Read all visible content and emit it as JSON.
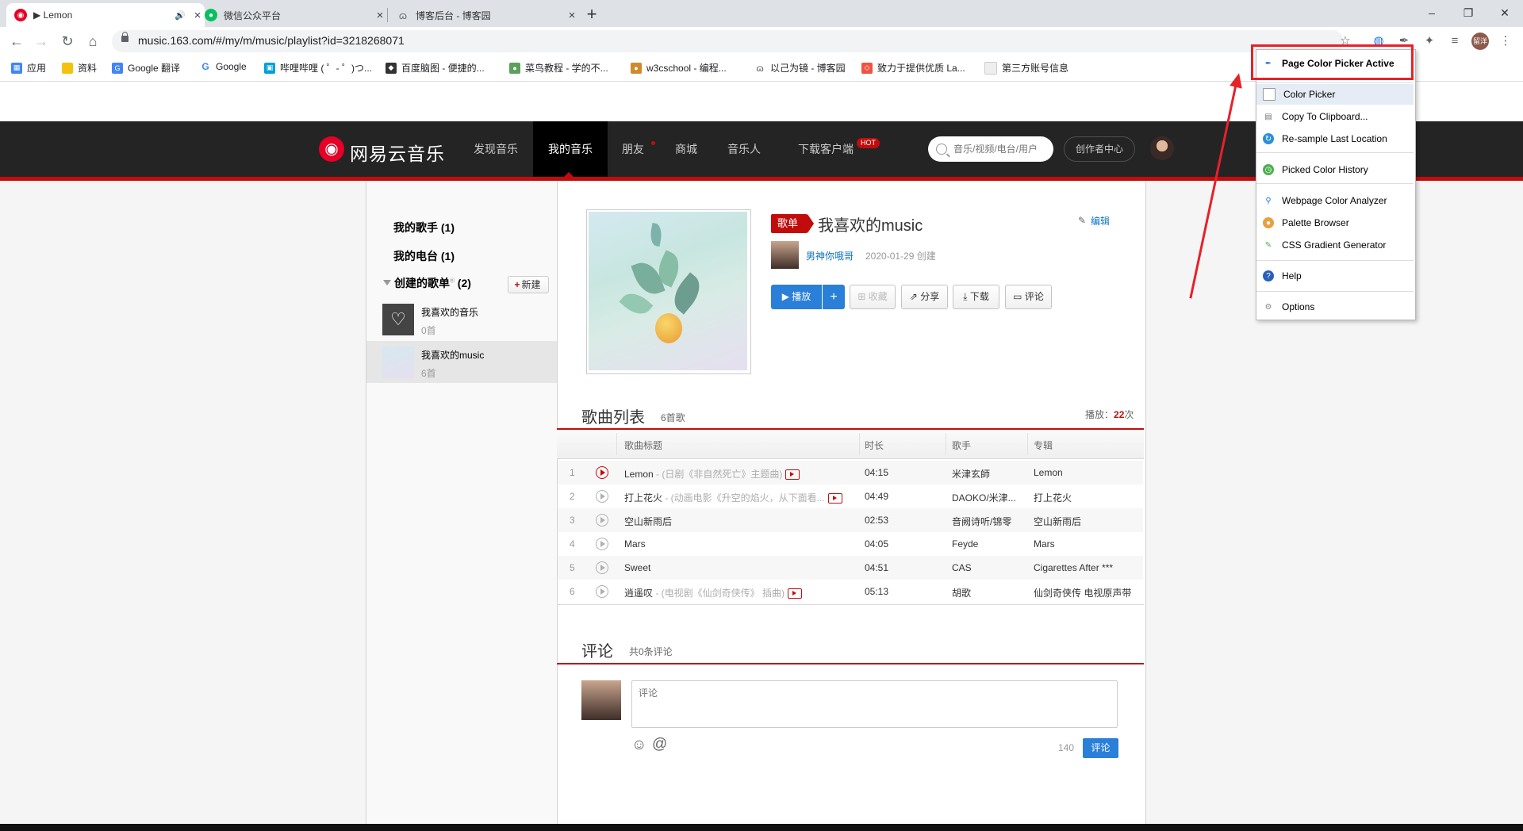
{
  "browser": {
    "tabs": [
      {
        "title": "▶ Lemon",
        "active": true
      },
      {
        "title": "微信公众平台",
        "active": false
      },
      {
        "title": "博客后台 - 博客园",
        "active": false
      }
    ],
    "url": "music.163.com/#/my/m/music/playlist?id=3218268071",
    "bookmarks": [
      "应用",
      "资料",
      "Google 翻译",
      "Google",
      "哔哩哔哩 ( ゜- ゜)つ...",
      "百度脑图 - 便捷的...",
      "菜鸟教程 - 学的不...",
      "w3cschool - 编程...",
      "以己为镜 - 博客园",
      "致力于提供优质 La...",
      "第三方账号信息"
    ],
    "profile_label": "留洋"
  },
  "site": {
    "logo_text": "网易云音乐",
    "nav": [
      "发现音乐",
      "我的音乐",
      "朋友",
      "商城",
      "音乐人",
      "下载客户端"
    ],
    "hot_badge": "HOT",
    "search_placeholder": "音乐/视频/电台/用户",
    "creator_center": "创作者中心"
  },
  "sidebar": {
    "my_singers": "我的歌手 (1)",
    "my_radio": "我的电台 (1)",
    "created_playlists": "创建的歌单",
    "created_count": "(2)",
    "new_button": "新建",
    "playlists": [
      {
        "name": "我喜欢的音乐",
        "count": "0首"
      },
      {
        "name": "我喜欢的music",
        "count": "6首"
      }
    ]
  },
  "playlist": {
    "tag": "歌单",
    "title": "我喜欢的music",
    "edit": "编辑",
    "creator": "男神你哦哥",
    "created": "2020-01-29 创建",
    "actions": {
      "play": "播放",
      "collect": "收藏",
      "share": "分享",
      "download": "下载",
      "comment": "评论"
    }
  },
  "songlist": {
    "title": "歌曲列表",
    "count": "6首歌",
    "plays_label": "播放：",
    "plays_value": "22",
    "plays_unit": "次",
    "headers": [
      "歌曲标题",
      "时长",
      "歌手",
      "专辑"
    ],
    "rows": [
      {
        "n": "1",
        "title": "Lemon",
        "sub": " - (日剧《非自然死亡》主题曲)",
        "mv": true,
        "dur": "04:15",
        "artist": "米津玄師",
        "album": "Lemon",
        "current": true
      },
      {
        "n": "2",
        "title": "打上花火",
        "sub": " - (动画电影《升空的焰火，从下面看...",
        "mv": true,
        "dur": "04:49",
        "artist": "DAOKO/米津...",
        "album": "打上花火"
      },
      {
        "n": "3",
        "title": "空山新雨后",
        "sub": "",
        "mv": false,
        "dur": "02:53",
        "artist": "音阙诗听/锦零",
        "album": "空山新雨后"
      },
      {
        "n": "4",
        "title": "Mars",
        "sub": "",
        "mv": false,
        "dur": "04:05",
        "artist": "Feyde",
        "album": "Mars"
      },
      {
        "n": "5",
        "title": "Sweet",
        "sub": "",
        "mv": false,
        "dur": "04:51",
        "artist": "CAS",
        "album": "Cigarettes After ***"
      },
      {
        "n": "6",
        "title": "逍遥叹",
        "sub": " - (电视剧《仙剑奇侠传》 插曲)",
        "mv": true,
        "dur": "05:13",
        "artist": "胡歌",
        "album": "仙剑奇侠传 电视原声带"
      }
    ]
  },
  "comments": {
    "title": "评论",
    "count": "共0条评论",
    "placeholder": "评论",
    "limit": "140",
    "submit": "评论"
  },
  "extension_menu": {
    "items": [
      "Page Color Picker Active",
      "Color Picker",
      "Copy To Clipboard...",
      "Re-sample Last Location",
      "Picked Color History",
      "Webpage Color Analyzer",
      "Palette Browser",
      "CSS Gradient Generator",
      "Help",
      "Options"
    ]
  },
  "colors": {
    "brand_red": "#c20c0c",
    "nav_bg": "#242424",
    "link_blue": "#0c73c2",
    "annotation_red": "#e8202a"
  }
}
